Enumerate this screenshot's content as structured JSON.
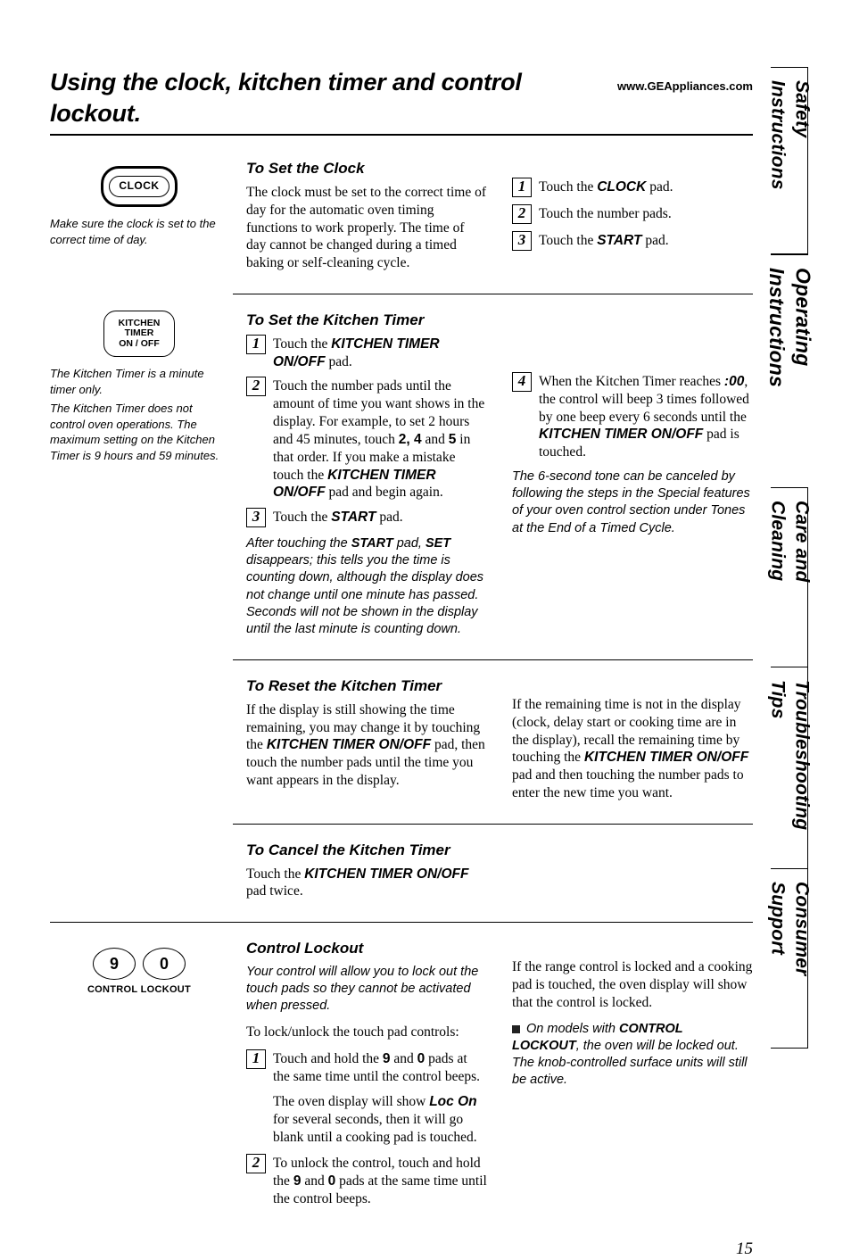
{
  "header": {
    "title": "Using the clock, kitchen timer and control lockout.",
    "url": "www.GEAppliances.com"
  },
  "tabs": {
    "safety": "Safety Instructions",
    "operating": "Operating Instructions",
    "care": "Care and Cleaning",
    "troubleshooting": "Troubleshooting Tips",
    "consumer": "Consumer Support"
  },
  "clock": {
    "btn": "CLOCK",
    "caption": "Make sure the clock is set to the correct time of day.",
    "head": "To Set the Clock",
    "intro": "The clock must be set to the correct time of day for the automatic oven timing functions to work properly. The time of day cannot be changed during a timed baking or self-cleaning cycle.",
    "s1a": "Touch the ",
    "s1b": "CLOCK",
    "s1c": " pad.",
    "s2": "Touch the number pads.",
    "s3a": "Touch the ",
    "s3b": "START",
    "s3c": " pad."
  },
  "kt": {
    "btn1": "KITCHEN",
    "btn2": "TIMER",
    "btn3": "ON / OFF",
    "cap1": "The Kitchen Timer is a minute timer only.",
    "cap2": "The Kitchen Timer does not control oven operations. The maximum setting on the Kitchen Timer is 9 hours and 59 minutes.",
    "head": "To Set the Kitchen Timer",
    "s1a": "Touch the ",
    "s1b": "KITCHEN TIMER ON/OFF",
    "s1c": " pad.",
    "s2a": "Touch the number pads until the amount of time you want shows in the display. For example, to set 2 hours and 45 minutes, touch ",
    "s2b": "2, 4",
    "s2c": " and ",
    "s2d": "5",
    "s2e": " in that order. If you make a mistake touch the ",
    "s2f": "KITCHEN TIMER ON/OFF",
    "s2g": " pad and begin again.",
    "s3a": "Touch the ",
    "s3b": "START",
    "s3c": " pad.",
    "note3a": "After touching the ",
    "note3b": "START",
    "note3c": " pad, ",
    "note3d": "SET",
    "note3e": " disappears; this tells you the time is counting down, although the display does not change until one minute has passed. Seconds will not be shown in the display until the last minute is counting down.",
    "s4a": "When the Kitchen Timer reaches ",
    "s4b": ":00",
    "s4c": ", the control will beep 3 times followed by one beep every 6 seconds until the ",
    "s4d": "KITCHEN TIMER ON/OFF",
    "s4e": " pad is touched.",
    "note4": "The 6-second tone can be canceled by following the steps in the Special features of your oven control section under Tones at the End of a Timed Cycle."
  },
  "reset": {
    "head": "To Reset the Kitchen Timer",
    "l1a": "If the display is still showing the time remaining, you may change it by touching the ",
    "l1b": "KITCHEN TIMER ON/OFF",
    "l1c": " pad, then touch the number pads until the time you want appears in the display.",
    "r1a": "If the remaining time is not in the display (clock, delay start or cooking time are in the display), recall the remaining time by touching the ",
    "r1b": "KITCHEN TIMER ON/OFF",
    "r1c": " pad and then touching the number pads to enter the new time you want."
  },
  "cancel": {
    "head": "To Cancel the Kitchen Timer",
    "a": "Touch the ",
    "b": "KITCHEN TIMER ON/OFF",
    "c": " pad twice."
  },
  "lockout": {
    "label": "CONTROL LOCKOUT",
    "nine": "9",
    "zero": "0",
    "head": "Control Lockout",
    "intro": "Your control will allow you to lock out the touch pads so they cannot be activated when pressed.",
    "p1": "To lock/unlock the touch pad controls:",
    "s1a": "Touch and hold the ",
    "s1b": "9",
    "s1c": " and ",
    "s1d": "0",
    "s1e": " pads at the same time until the control beeps.",
    "p2a": "The oven display will show ",
    "p2b": "Loc On",
    "p2c": " for several seconds, then it will go blank until a cooking pad is touched.",
    "s2a": "To unlock the control, touch and hold the ",
    "s2b": "9",
    "s2c": " and ",
    "s2d": "0",
    "s2e": " pads at the same time until the control beeps.",
    "r1": "If the range control is locked and a cooking pad is touched, the oven display will show that the control is locked.",
    "r2a": "On models with ",
    "r2b": "CONTROL LOCKOUT",
    "r2c": ", the oven will be locked out. The knob-controlled surface units will still be active."
  },
  "pagenum": "15"
}
